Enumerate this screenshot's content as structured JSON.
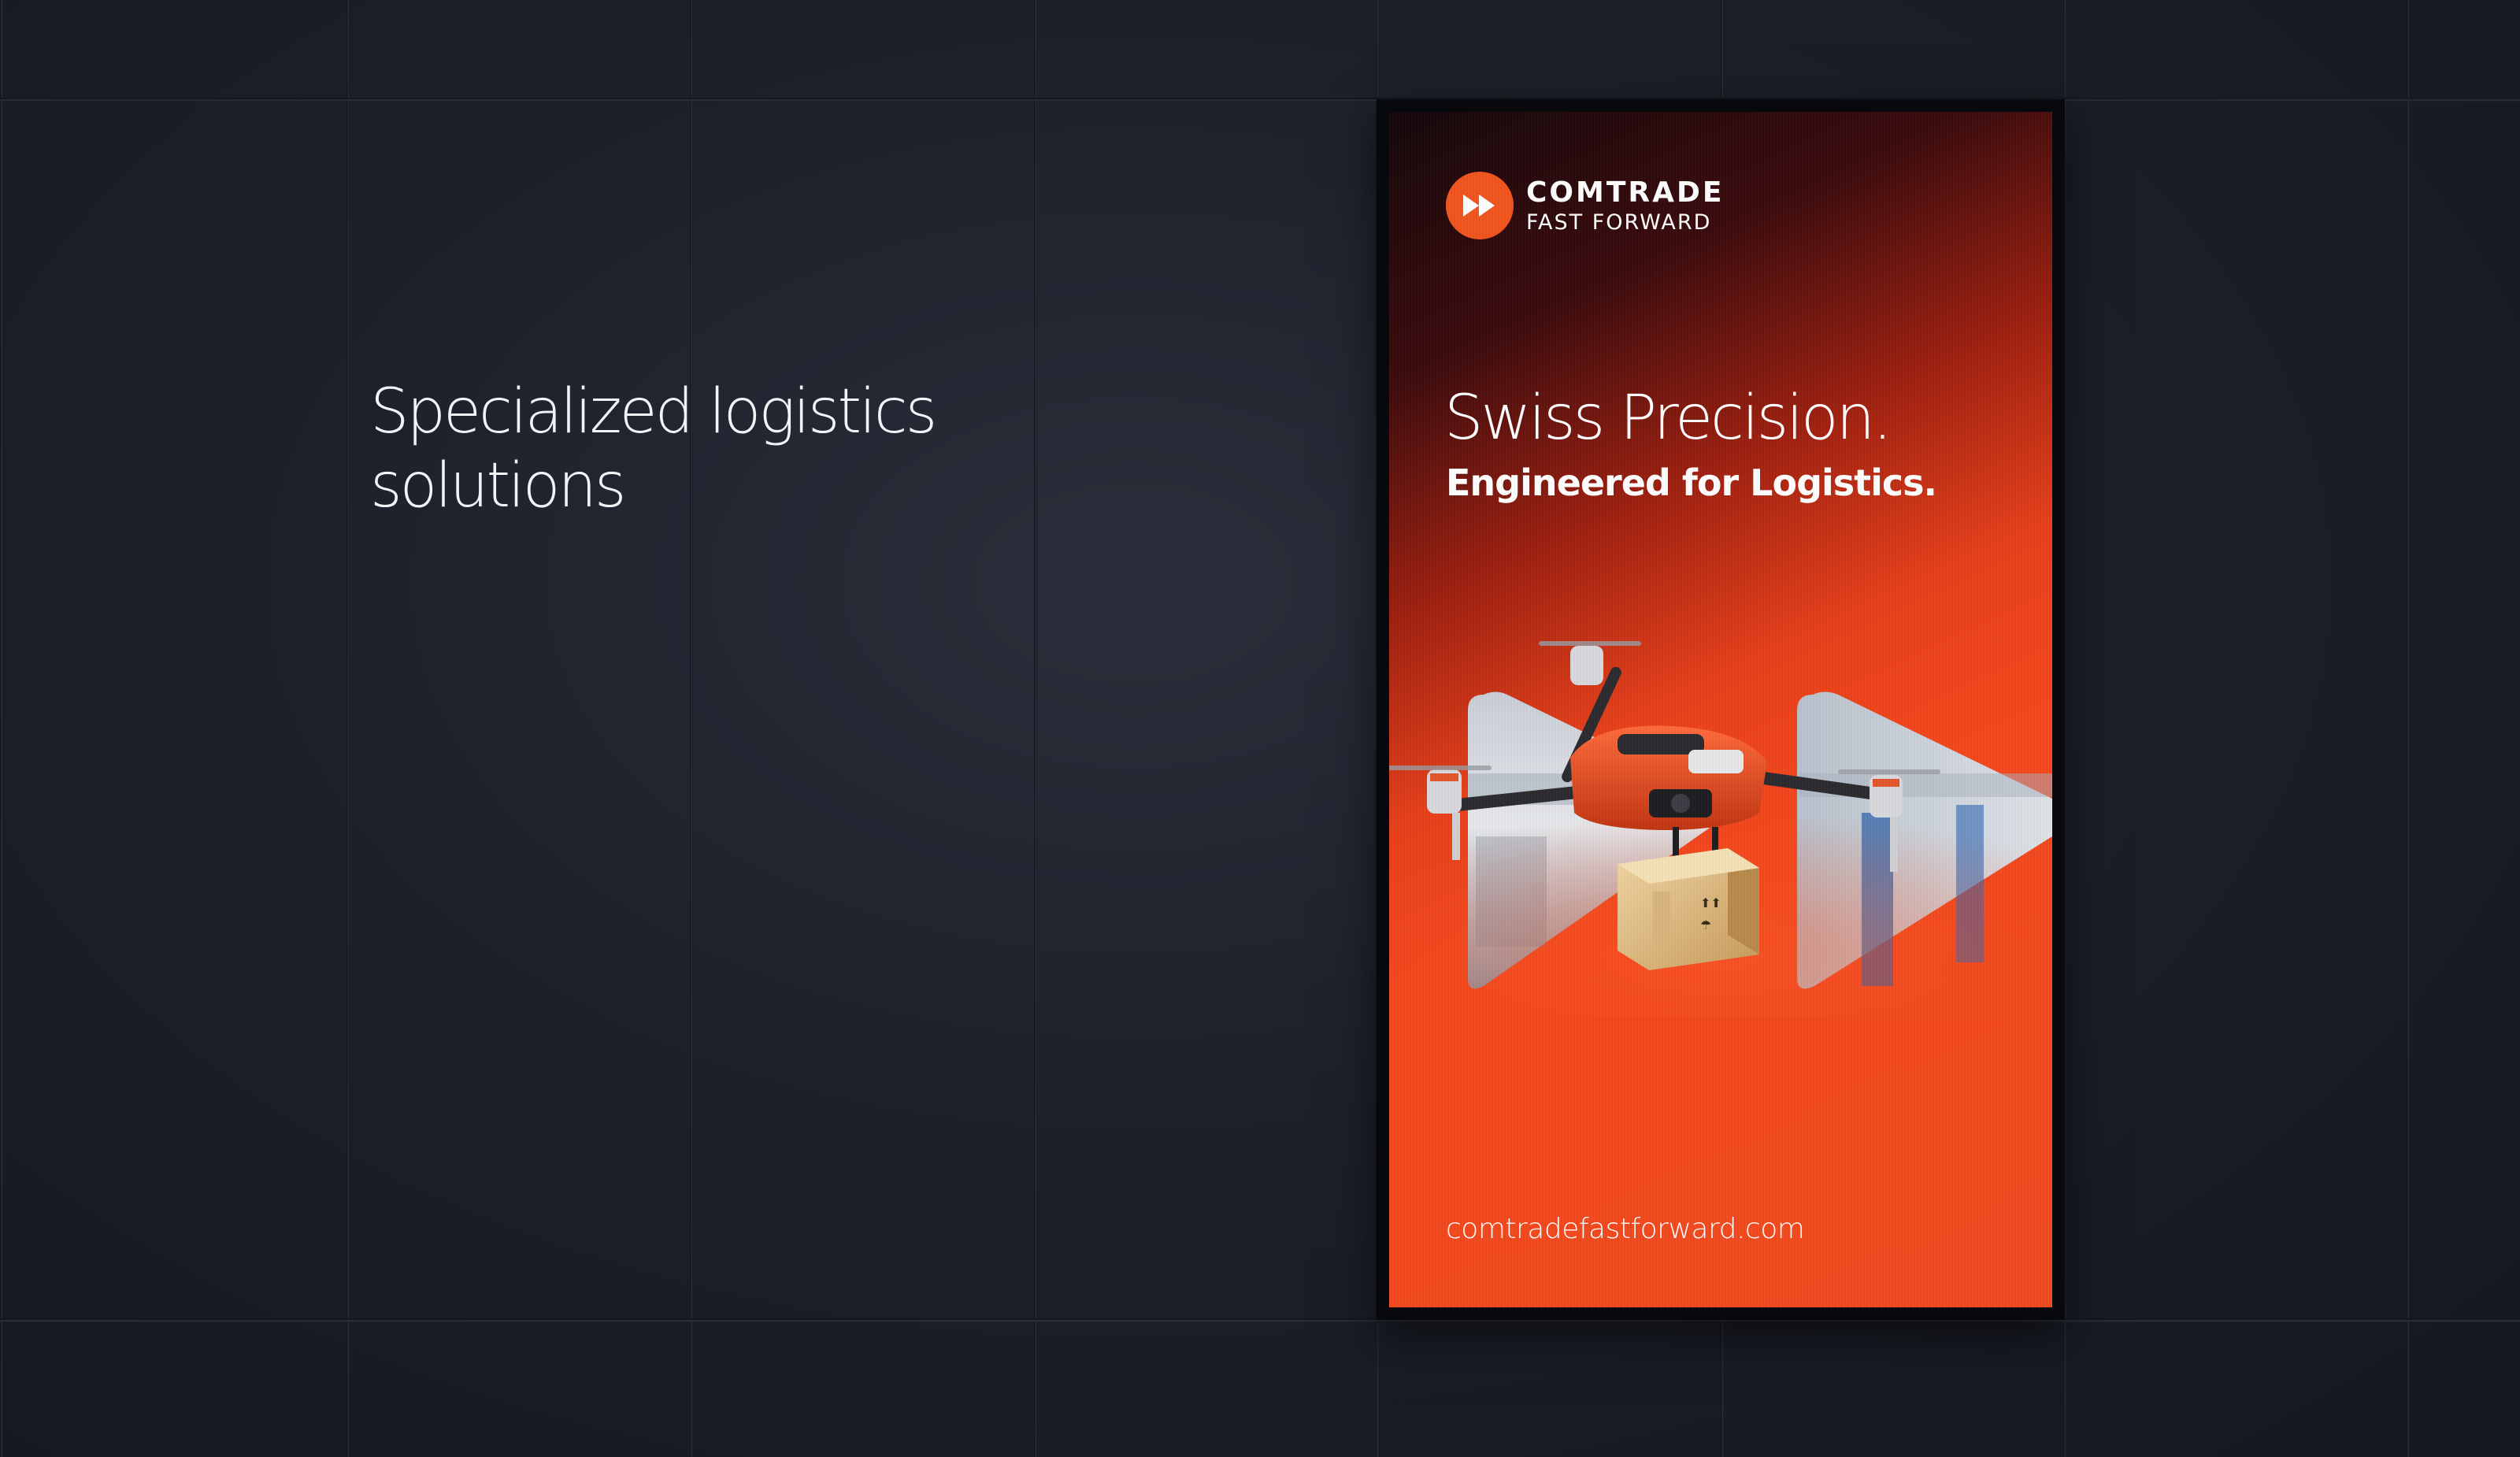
{
  "page": {
    "headline_line1": "Specialized logistics",
    "headline_line2": "solutions"
  },
  "billboard": {
    "logo": {
      "line1": "COMTRADE",
      "line2": "FAST FORWARD",
      "icon": "fast-forward-icon",
      "color": "#f2541d"
    },
    "title": "Swiss Precision.",
    "subtitle": "Engineered for Logistics.",
    "url": "comtradefastforward.com",
    "image": "delivery-drone-carrying-box",
    "accent_color": "#f5471c"
  },
  "colors": {
    "wall": "#1d202a",
    "text": "#f2f3f6",
    "screen_orange": "#f04a1f"
  }
}
